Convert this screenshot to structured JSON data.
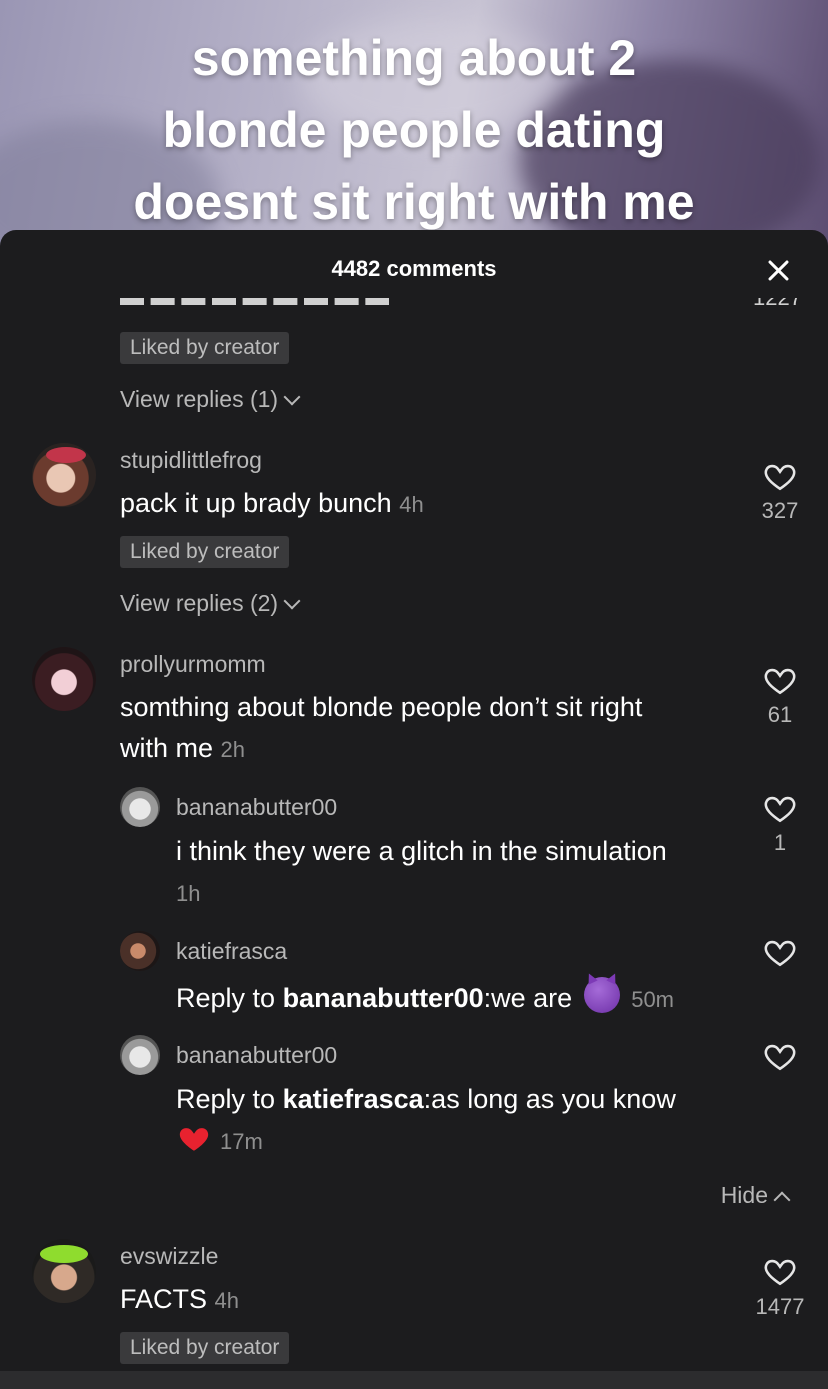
{
  "video": {
    "caption": "something about 2 blonde people dating doesnt sit right with me"
  },
  "sheet": {
    "title": "4482 comments",
    "close_icon": "close-icon"
  },
  "cut_off": {
    "count": "1227"
  },
  "liked_badge": "Liked by creator",
  "view_replies_1": "View replies (1)",
  "comments": [
    {
      "username": "stupidlittlefrog",
      "text": "pack it up brady bunch",
      "time": "4h",
      "likes": "327",
      "badge": "Liked by creator",
      "view_replies": "View replies (2)"
    },
    {
      "username": "prollyurmomm",
      "text_line1": "somthing about blonde people don’t sit right",
      "text_line2": "with me",
      "time": "2h",
      "likes": "61"
    },
    {
      "username": "evswizzle",
      "text": "FACTS",
      "time": "4h",
      "likes": "1477",
      "badge": "Liked by creator"
    }
  ],
  "replies": [
    {
      "username": "bananabutter00",
      "text": "i think they were a glitch in the simulation",
      "time": "1h",
      "likes": "1"
    },
    {
      "username": "katiefrasca",
      "reply_prefix": "Reply to ",
      "reply_to": "bananabutter00",
      "text": ":we are",
      "emoji": "smiling-devil-emoji",
      "time": "50m"
    },
    {
      "username": "bananabutter00",
      "reply_prefix": "Reply to ",
      "reply_to": "katiefrasca",
      "text": ":as long as you know",
      "emoji": "red-heart-emoji",
      "time": "17m"
    }
  ],
  "hide_label": "Hide"
}
